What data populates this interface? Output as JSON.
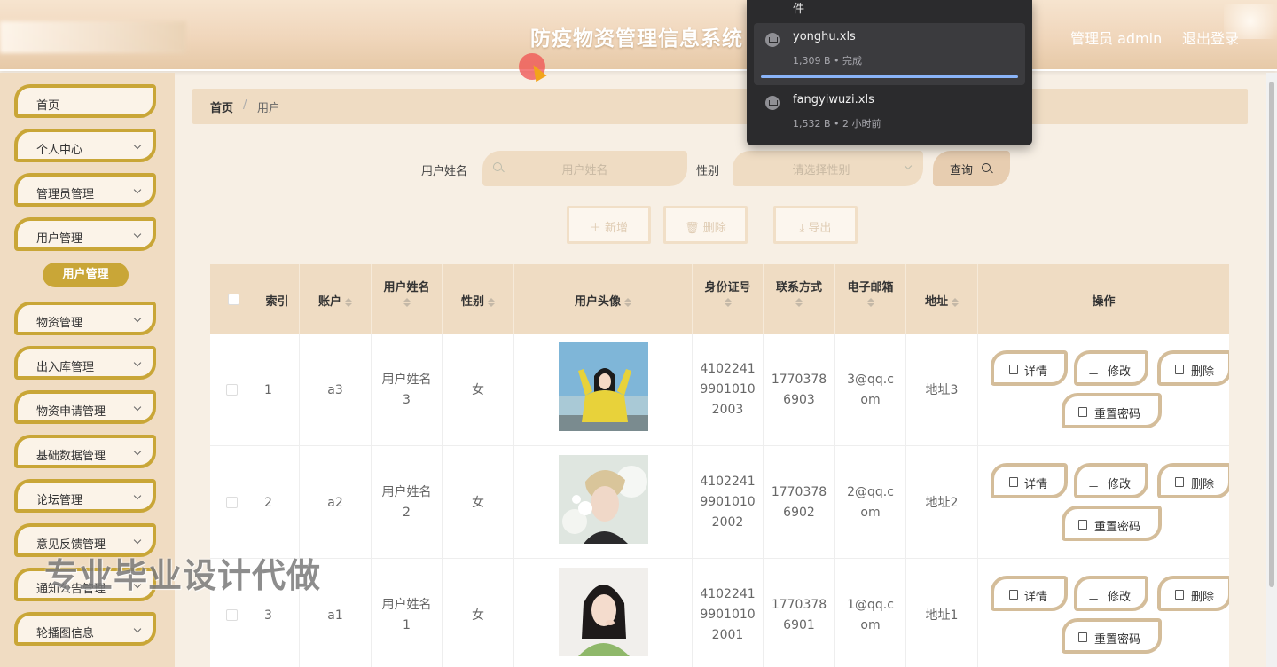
{
  "header": {
    "title": "防疫物资管理信息系统",
    "user": "管理员 admin",
    "logout": "退出登录"
  },
  "downloads": {
    "truncated": "件",
    "items": [
      {
        "name": "yonghu.xls",
        "status": "1,309 B • 完成"
      },
      {
        "name": "fangyiwuzi.xls",
        "status": "1,532 B • 2 小时前"
      }
    ]
  },
  "sidebar": {
    "items": [
      {
        "label": "首页"
      },
      {
        "label": "个人中心"
      },
      {
        "label": "管理员管理"
      },
      {
        "label": "用户管理"
      },
      {
        "label": "物资管理"
      },
      {
        "label": "出入库管理"
      },
      {
        "label": "物资申请管理"
      },
      {
        "label": "基础数据管理"
      },
      {
        "label": "论坛管理"
      },
      {
        "label": "意见反馈管理"
      },
      {
        "label": "通知公告管理"
      },
      {
        "label": "轮播图信息"
      }
    ],
    "submenu": "用户管理"
  },
  "breadcrumb": {
    "home": "首页",
    "sep": "/",
    "current": "用户"
  },
  "search": {
    "name_label": "用户姓名",
    "name_placeholder": "用户姓名",
    "gender_label": "性别",
    "gender_placeholder": "请选择性别",
    "query": "查询"
  },
  "actions": {
    "add": "＋ 新增",
    "delete": "🗑 删除",
    "export": "⤓ 导出"
  },
  "table": {
    "headers": [
      "索引",
      "账户",
      "用户姓名",
      "性别",
      "用户头像",
      "身份证号",
      "联系方式",
      "电子邮箱",
      "地址",
      "操作"
    ],
    "rows": [
      {
        "index": "1",
        "account": "a3",
        "name": [
          "用户姓名",
          "3"
        ],
        "gender": "女",
        "idcard": [
          "4102241",
          "9901010",
          "2003"
        ],
        "phone": [
          "1770378",
          "6903"
        ],
        "email": [
          "3@qq.c",
          "om"
        ],
        "address": "地址3"
      },
      {
        "index": "2",
        "account": "a2",
        "name": [
          "用户姓名",
          "2"
        ],
        "gender": "女",
        "idcard": [
          "4102241",
          "9901010",
          "2002"
        ],
        "phone": [
          "1770378",
          "6902"
        ],
        "email": [
          "2@qq.c",
          "om"
        ],
        "address": "地址2"
      },
      {
        "index": "3",
        "account": "a1",
        "name": [
          "用户姓名",
          "1"
        ],
        "gender": "女",
        "idcard": [
          "4102241",
          "9901010",
          "2001"
        ],
        "phone": [
          "1770378",
          "6901"
        ],
        "email": [
          "1@qq.c",
          "om"
        ],
        "address": "地址1"
      }
    ],
    "ops": {
      "detail": "详情",
      "edit": "修改",
      "delete": "删除",
      "reset": "重置密码"
    }
  },
  "watermark": "专业毕业设计代做"
}
